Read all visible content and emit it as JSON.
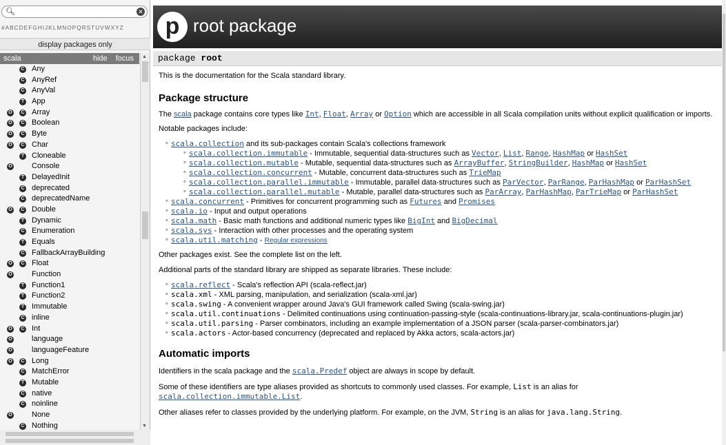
{
  "search": {
    "placeholder": "",
    "icon": "search-icon",
    "clear_icon": "clear-icon"
  },
  "letters": "#ABCDEFGHIJKLMNOPQRSTUVWXYZ",
  "display_packages_only": "display packages only",
  "package_header": {
    "name": "scala",
    "hide": "hide",
    "focus": "focus"
  },
  "types": [
    {
      "name": "Any",
      "b1": "",
      "b2": "C"
    },
    {
      "name": "AnyRef",
      "b1": "",
      "b2": "C"
    },
    {
      "name": "AnyVal",
      "b1": "",
      "b2": "C"
    },
    {
      "name": "App",
      "b1": "",
      "b2": "T"
    },
    {
      "name": "Array",
      "b1": "O",
      "b2": "C"
    },
    {
      "name": "Boolean",
      "b1": "O",
      "b2": "C"
    },
    {
      "name": "Byte",
      "b1": "O",
      "b2": "C"
    },
    {
      "name": "Char",
      "b1": "O",
      "b2": "C"
    },
    {
      "name": "Cloneable",
      "b1": "",
      "b2": "T"
    },
    {
      "name": "Console",
      "b1": "O",
      "b2": ""
    },
    {
      "name": "DelayedInit",
      "b1": "",
      "b2": "T"
    },
    {
      "name": "deprecated",
      "b1": "",
      "b2": "C"
    },
    {
      "name": "deprecatedName",
      "b1": "",
      "b2": "C"
    },
    {
      "name": "Double",
      "b1": "O",
      "b2": "C"
    },
    {
      "name": "Dynamic",
      "b1": "",
      "b2": "T"
    },
    {
      "name": "Enumeration",
      "b1": "",
      "b2": "C"
    },
    {
      "name": "Equals",
      "b1": "",
      "b2": "T"
    },
    {
      "name": "FallbackArrayBuilding",
      "b1": "",
      "b2": "C"
    },
    {
      "name": "Float",
      "b1": "O",
      "b2": "C"
    },
    {
      "name": "Function",
      "b1": "O",
      "b2": ""
    },
    {
      "name": "Function1",
      "b1": "",
      "b2": "T"
    },
    {
      "name": "Function2",
      "b1": "",
      "b2": "T"
    },
    {
      "name": "Immutable",
      "b1": "",
      "b2": "T"
    },
    {
      "name": "inline",
      "b1": "",
      "b2": "C"
    },
    {
      "name": "Int",
      "b1": "O",
      "b2": "C"
    },
    {
      "name": "language",
      "b1": "O",
      "b2": ""
    },
    {
      "name": "languageFeature",
      "b1": "O",
      "b2": ""
    },
    {
      "name": "Long",
      "b1": "O",
      "b2": "C"
    },
    {
      "name": "MatchError",
      "b1": "",
      "b2": "C"
    },
    {
      "name": "Mutable",
      "b1": "",
      "b2": "T"
    },
    {
      "name": "native",
      "b1": "",
      "b2": "C"
    },
    {
      "name": "noinline",
      "b1": "",
      "b2": "C"
    },
    {
      "name": "None",
      "b1": "O",
      "b2": ""
    },
    {
      "name": "Nothing",
      "b1": "",
      "b2": "C"
    }
  ],
  "header": {
    "logo": "p",
    "title": "root package"
  },
  "signature": {
    "kind": "package",
    "name": "root"
  },
  "content": {
    "intro": "This is the documentation for the Scala standard library.",
    "h_structure": "Package structure",
    "structure_p": {
      "a": "The ",
      "scala": "scala",
      "b": " package contains core types like ",
      "int": "Int",
      "c": ", ",
      "float": "Float",
      "d": ", ",
      "array": "Array",
      "e": " or ",
      "option": "Option",
      "f": " which are accessible in all Scala compilation units without explicit qualification or imports."
    },
    "notable": "Notable packages include:",
    "collection": {
      "link": "scala.collection",
      "text": " and its sub-packages contain Scala's collections framework"
    },
    "sub": [
      {
        "link": "scala.collection.immutable",
        "text": " - Immutable, sequential data-structures such as ",
        "refs": [
          "Vector",
          "List",
          "Range",
          "HashMap"
        ],
        "last": "HashSet"
      },
      {
        "link": "scala.collection.mutable",
        "text": " - Mutable, sequential data-structures such as ",
        "refs": [
          "ArrayBuffer",
          "StringBuilder",
          "HashMap"
        ],
        "last": "HashSet"
      },
      {
        "link": "scala.collection.concurrent",
        "text": " - Mutable, concurrent data-structures such as ",
        "refs": [],
        "last": "TrieMap"
      },
      {
        "link": "scala.collection.parallel.immutable",
        "text": " - Immutable, parallel data-structures such as ",
        "refs": [
          "ParVector",
          "ParRange",
          "ParHashMap"
        ],
        "last": "ParHashSet"
      },
      {
        "link": "scala.collection.parallel.mutable",
        "text": " - Mutable, parallel data-structures such as ",
        "refs": [
          "ParArray",
          "ParHashMap",
          "ParTrieMap"
        ],
        "last": "ParHashSet"
      }
    ],
    "concurrent": {
      "link": "scala.concurrent",
      "text": " - Primitives for concurrent programming such as ",
      "a": "Futures",
      "and": " and ",
      "b": "Promises"
    },
    "io": {
      "link": "scala.io",
      "text": " - Input and output operations"
    },
    "math": {
      "link": "scala.math",
      "text": " - Basic math functions and additional numeric types like ",
      "a": "BigInt",
      "and": " and ",
      "b": "BigDecimal"
    },
    "sys": {
      "link": "scala.sys",
      "text": " - Interaction with other processes and the operating system"
    },
    "matching": {
      "link": "scala.util.matching",
      "text": " - ",
      "a": "Regular expressions"
    },
    "other": "Other packages exist. See the complete list on the left.",
    "additional": "Additional parts of the standard library are shipped as separate libraries. These include:",
    "libs": [
      {
        "name": "scala.reflect",
        "link": true,
        "text": " - Scala's reflection API (scala-reflect.jar)"
      },
      {
        "name": "scala.xml",
        "link": false,
        "text": " - XML parsing, manipulation, and serialization (scala-xml.jar)"
      },
      {
        "name": "scala.swing",
        "link": false,
        "text": " - A convenient wrapper around Java's GUI framework called Swing (scala-swing.jar)"
      },
      {
        "name": "scala.util.continuations",
        "link": false,
        "text": " - Delimited continuations using continuation-passing-style (scala-continuations-library.jar, scala-continuations-plugin.jar)"
      },
      {
        "name": "scala.util.parsing",
        "link": false,
        "text": " - Parser combinators, including an example implementation of a JSON parser (scala-parser-combinators.jar)"
      },
      {
        "name": "scala.actors",
        "link": false,
        "text": " - Actor-based concurrency (deprecated and replaced by Akka actors, scala-actors.jar)"
      }
    ],
    "h_imports": "Automatic imports",
    "imports_p1": {
      "a": "Identifiers in the scala package and the ",
      "link": "scala.Predef",
      "b": " object are always in scope by default."
    },
    "imports_p2": {
      "a": "Some of these identifiers are type aliases provided as shortcuts to commonly used classes. For example, ",
      "code": "List",
      "b": " is an alias for",
      "link": "scala.collection.immutable.List",
      "c": "."
    },
    "imports_p3": {
      "a": "Other aliases refer to classes provided by the underlying platform. For example, on the JVM, ",
      "code1": "String",
      "b": " is an alias for ",
      "code2": "java.lang.String",
      "c": "."
    }
  }
}
